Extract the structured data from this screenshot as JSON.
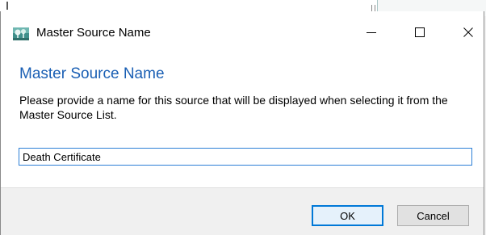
{
  "window": {
    "title": "Master Source Name"
  },
  "titlebar_buttons": {
    "minimize_glyph": "—",
    "close_glyph": "✕"
  },
  "content": {
    "heading": "Master Source Name",
    "description": "Please provide a name for this source that will be displayed when selecting it from the Master Source List."
  },
  "input": {
    "value": "Death Certificate"
  },
  "buttons": {
    "ok_label": "OK",
    "cancel_label": "Cancel"
  },
  "colors": {
    "heading": "#1a5fb4",
    "focus_border": "#0078d7"
  }
}
